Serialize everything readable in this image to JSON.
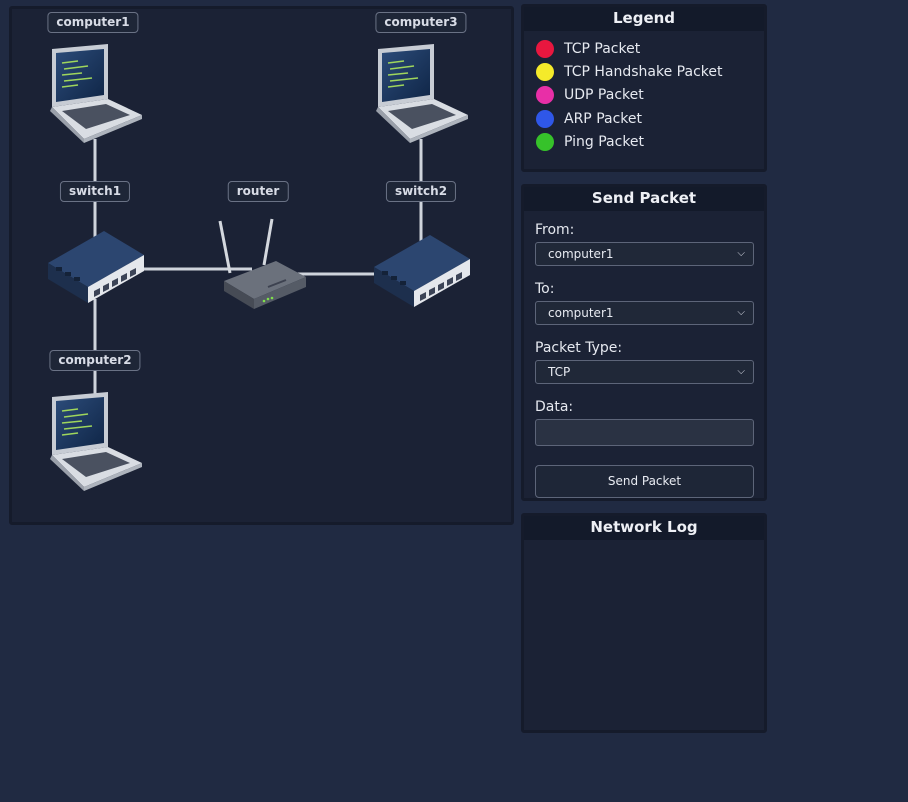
{
  "topology": {
    "nodes": [
      {
        "id": "computer1",
        "label": "computer1",
        "type": "laptop"
      },
      {
        "id": "computer3",
        "label": "computer3",
        "type": "laptop"
      },
      {
        "id": "switch1",
        "label": "switch1",
        "type": "switch"
      },
      {
        "id": "router",
        "label": "router",
        "type": "router"
      },
      {
        "id": "switch2",
        "label": "switch2",
        "type": "switch"
      },
      {
        "id": "computer2",
        "label": "computer2",
        "type": "laptop"
      }
    ]
  },
  "legend": {
    "title": "Legend",
    "items": [
      {
        "label": "TCP Packet",
        "color": "#e8173f"
      },
      {
        "label": "TCP Handshake Packet",
        "color": "#f5ea2a"
      },
      {
        "label": "UDP Packet",
        "color": "#e82fa7"
      },
      {
        "label": "ARP Packet",
        "color": "#2f57e8"
      },
      {
        "label": "Ping Packet",
        "color": "#36c22a"
      }
    ]
  },
  "send": {
    "title": "Send Packet",
    "from_label": "From:",
    "from_value": "computer1",
    "to_label": "To:",
    "to_value": "computer1",
    "type_label": "Packet Type:",
    "type_value": "TCP",
    "data_label": "Data:",
    "data_value": "",
    "button": "Send Packet"
  },
  "log": {
    "title": "Network Log"
  }
}
